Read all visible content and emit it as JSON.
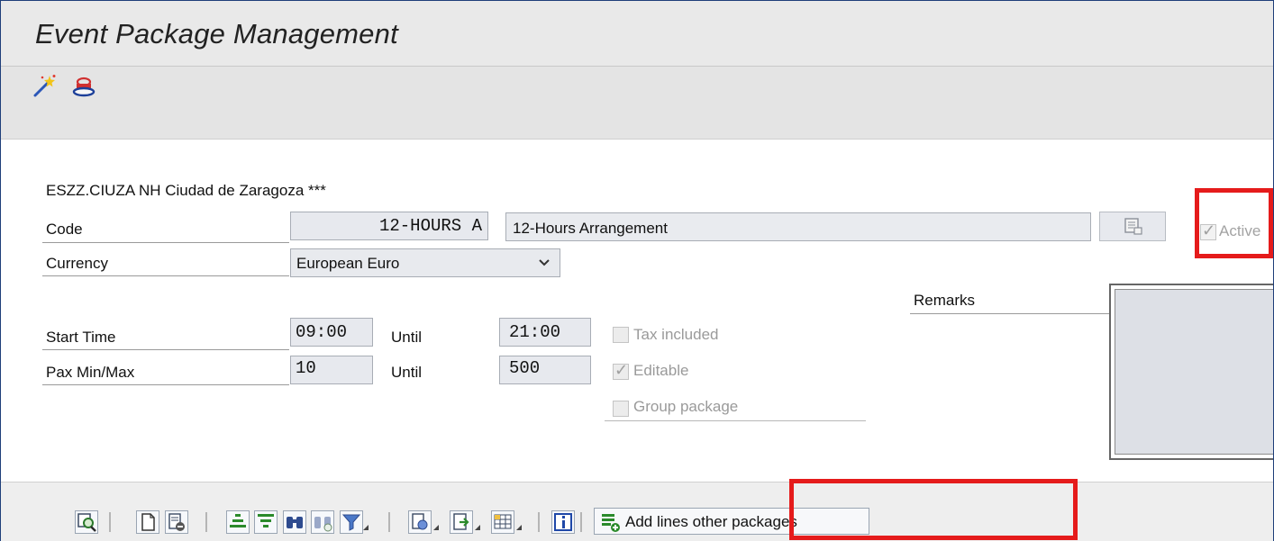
{
  "window": {
    "title": "Event Package Management"
  },
  "header": {
    "hotel": "ESZZ.CIUZA NH Ciudad de Zaragoza ***"
  },
  "form": {
    "code_label": "Code",
    "code_value": "12-HOURS A",
    "code_description": "12-Hours Arrangement",
    "active_label": "Active",
    "currency_label": "Currency",
    "currency_value": "European Euro",
    "remarks_label": "Remarks",
    "start_time_label": "Start Time",
    "start_time_value": "09:00",
    "until_label": "Until",
    "end_time_value": "21:00",
    "pax_label": "Pax Min/Max",
    "pax_min": "10",
    "pax_until_label": "Until",
    "pax_max": "500",
    "tax_label": "Tax included",
    "editable_label": "Editable",
    "group_label": "Group package"
  },
  "toolbar": {
    "add_lines_label": "Add lines other packages"
  },
  "colors": {
    "highlight": "#e51b1b",
    "field_bg": "#e7e9ee",
    "bar_bg": "#e4e4e4"
  }
}
